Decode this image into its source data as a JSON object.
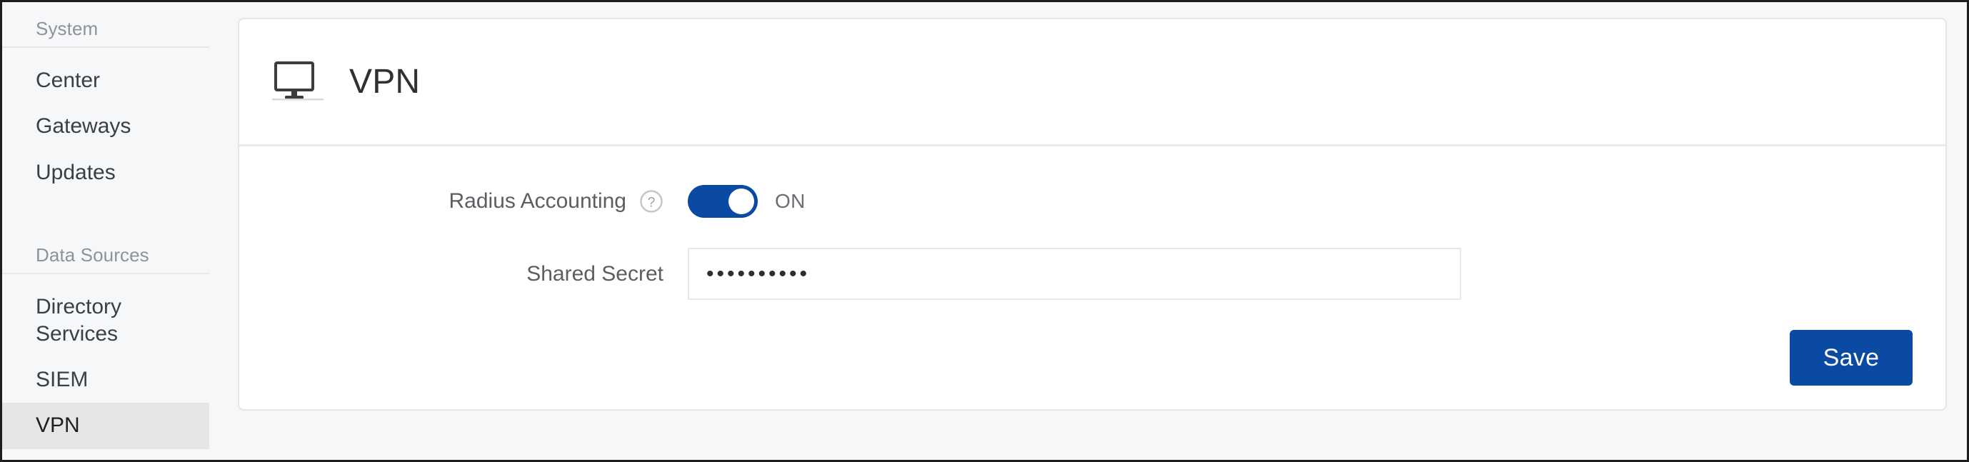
{
  "theme": {
    "accent_blue": "#0a4aa3",
    "page_background": "#f6f7f9",
    "card_background": "#ffffff",
    "border_gray": "#e5e6e8",
    "active_item_background": "#e5e6e8",
    "label_text": "#5b5f64",
    "muted_text": "#8f9296"
  },
  "sidebar": {
    "sections": [
      {
        "header": "System",
        "items": [
          {
            "label": "Center",
            "active": false
          },
          {
            "label": "Gateways",
            "active": false
          },
          {
            "label": "Updates",
            "active": false
          }
        ]
      },
      {
        "header": "Data Sources",
        "items": [
          {
            "label": "Directory Services",
            "active": false
          },
          {
            "label": "SIEM",
            "active": false
          },
          {
            "label": "VPN",
            "active": true
          }
        ]
      }
    ]
  },
  "card": {
    "header": {
      "icon": "monitor-icon",
      "title": "VPN"
    },
    "form": {
      "radius_accounting": {
        "label": "Radius Accounting",
        "help_icon": "help-circle-icon",
        "toggle_state": "ON",
        "toggle_on": true
      },
      "shared_secret": {
        "label": "Shared Secret",
        "value": "••••••••••",
        "placeholder": "",
        "masked_character_count": 10
      }
    },
    "actions": {
      "save_label": "Save"
    }
  }
}
